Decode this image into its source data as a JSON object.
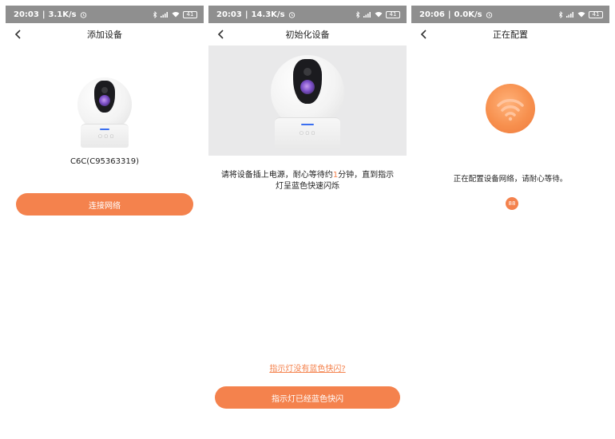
{
  "screens": [
    {
      "status": {
        "time": "20:03",
        "speed": "3.1K/s",
        "battery": "41"
      },
      "title": "添加设备",
      "model": "C6C(C95363319)",
      "button": "连接网络"
    },
    {
      "status": {
        "time": "20:03",
        "speed": "14.3K/s",
        "battery": "41"
      },
      "title": "初始化设备",
      "instruction": {
        "before": "请将设备插上电源，耐心等待约",
        "highlight": "1",
        "after": "分钟，直到指示灯呈蓝色快速闪烁"
      },
      "help_link": "指示灯没有蓝色快闪?",
      "button": "指示灯已经蓝色快闪"
    },
    {
      "status": {
        "time": "20:06",
        "speed": "0.0K/s",
        "battery": "41"
      },
      "title": "正在配置",
      "message": "正在配置设备网络，请耐心等待。",
      "progress": "88"
    }
  ],
  "colors": {
    "accent": "#f4824d",
    "statusbar": "#8f8f8f",
    "led": "#3b6ff0"
  },
  "icons": [
    "back-arrow-icon",
    "alarm-icon",
    "bluetooth-icon",
    "signal-icon",
    "wifi-icon",
    "battery-icon"
  ]
}
